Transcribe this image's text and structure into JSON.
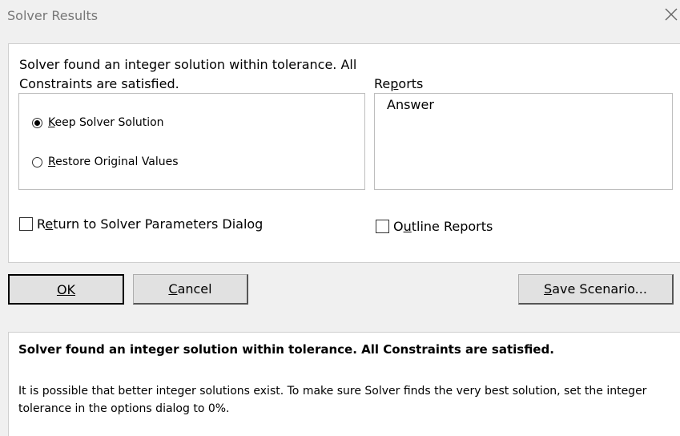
{
  "window": {
    "title": "Solver Results",
    "close_icon": "close-icon"
  },
  "status_message": "Solver found an integer solution within tolerance.  All Constraints are satisfied.",
  "options": {
    "keep": {
      "label": "Keep Solver Solution",
      "selected": true
    },
    "restore": {
      "label": "Restore Original Values",
      "selected": false
    }
  },
  "reports": {
    "label": "Reports",
    "items": [
      "Answer"
    ]
  },
  "checkboxes": {
    "return_to_params": {
      "label": "Return to Solver Parameters Dialog",
      "checked": false
    },
    "outline_reports": {
      "label": "Outline Reports",
      "checked": false
    }
  },
  "buttons": {
    "ok": "OK",
    "cancel": "Cancel",
    "save_scenario": "Save Scenario..."
  },
  "message": {
    "heading": "Solver found an integer solution within tolerance.  All Constraints are satisfied.",
    "body": "It is possible that better integer solutions exist. To make sure Solver finds the very best solution, set the integer tolerance in the options dialog to 0%."
  }
}
